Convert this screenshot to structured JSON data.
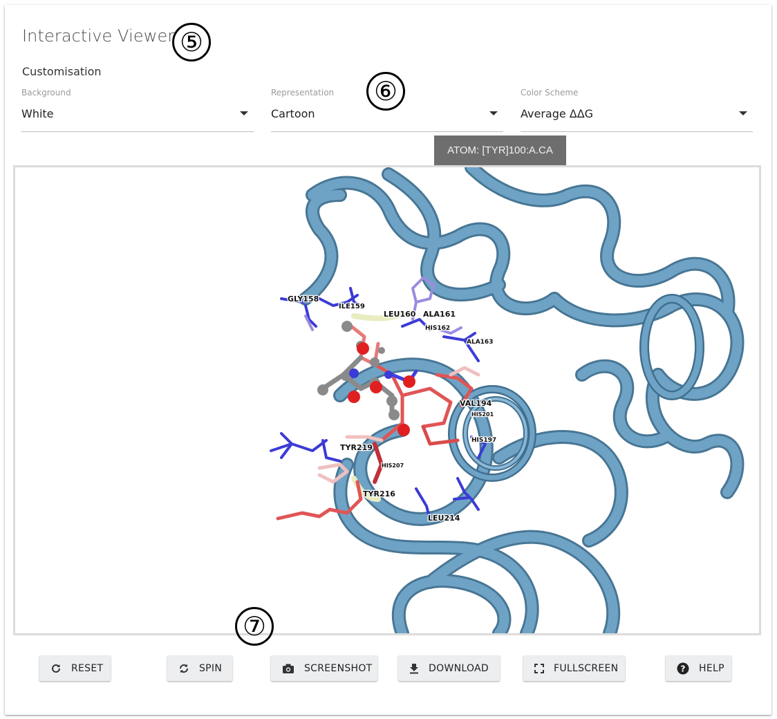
{
  "header": {
    "title": "Interactive Viewer",
    "subtitle": "Customisation",
    "callouts": [
      "⑤",
      "⑥",
      "⑦"
    ]
  },
  "controls": {
    "background": {
      "label": "Background",
      "value": "White"
    },
    "representation": {
      "label": "Representation",
      "value": "Cartoon"
    },
    "color_scheme": {
      "label": "Color Scheme",
      "value": "Average ΔΔG"
    }
  },
  "viewer": {
    "tooltip": "ATOM: [TYR]100:A.CA",
    "residue_labels": [
      "GLY158",
      "ILE159",
      "LEU160",
      "ALA161",
      "HIS162",
      "ALA163",
      "VAL194",
      "HIS201",
      "HIS197",
      "TYR219",
      "HIS207",
      "TYR216",
      "LEU214"
    ],
    "colors": {
      "ribbon": "#6fa3c5",
      "ribbon_dark": "#3f6f8f",
      "blue": "#3b3bd6",
      "lavender": "#9b8ce0",
      "red": "#e05555",
      "salmon": "#e88a8a",
      "pink": "#f0c0c0",
      "grey_atom": "#8a8a8a"
    }
  },
  "toolbar": {
    "reset": "RESET",
    "spin": "SPIN",
    "screenshot": "SCREENSHOT",
    "download": "DOWNLOAD",
    "fullscreen": "FULLSCREEN",
    "help": "HELP"
  }
}
